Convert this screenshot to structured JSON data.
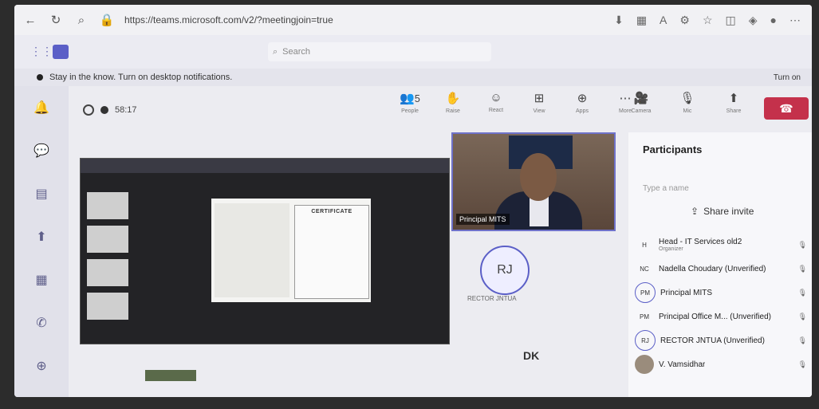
{
  "browser": {
    "url": "https://teams.microsoft.com/v2/?meetingjoin=true"
  },
  "teams": {
    "search_placeholder": "Search"
  },
  "notification": {
    "text": "Stay in the know. Turn on desktop notifications.",
    "action": "Turn on"
  },
  "meeting": {
    "timer": "58:17",
    "tools": [
      {
        "icon": "people-icon",
        "label": "People"
      },
      {
        "icon": "raise-hand-icon",
        "label": "Raise"
      },
      {
        "icon": "react-icon",
        "label": "React"
      },
      {
        "icon": "view-icon",
        "label": "View"
      },
      {
        "icon": "apps-icon",
        "label": "Apps"
      },
      {
        "icon": "more-icon",
        "label": "More"
      }
    ],
    "controls": [
      {
        "icon": "camera-icon",
        "label": "Camera"
      },
      {
        "icon": "mic-icon",
        "label": "Mic"
      },
      {
        "icon": "share-icon",
        "label": "Share"
      }
    ],
    "participant_count": "5",
    "slide_title": "CERTIFICATE",
    "video_name": "Principal MITS",
    "avatar_initials": "RJ",
    "avatar_name": "RECTOR JNTUA",
    "dk_initials": "DK"
  },
  "participants": {
    "title": "Participants",
    "input_placeholder": "Type a name",
    "share_invite": "Share invite",
    "list": [
      {
        "initials": "H",
        "name": "Head - IT Services old2",
        "sub": "Organizer"
      },
      {
        "initials": "NC",
        "name": "Nadella Choudary (Unverified)",
        "sub": ""
      },
      {
        "initials": "PM",
        "name": "Principal MITS",
        "sub": ""
      },
      {
        "initials": "PM",
        "name": "Principal Office M... (Unverified)",
        "sub": ""
      },
      {
        "initials": "RJ",
        "name": "RECTOR JNTUA (Unverified)",
        "sub": ""
      },
      {
        "initials": "",
        "name": "V. Vamsidhar",
        "sub": ""
      }
    ]
  }
}
